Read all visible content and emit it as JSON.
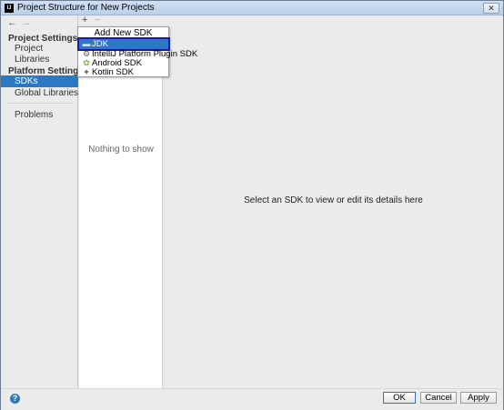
{
  "window": {
    "title": "Project Structure for New Projects",
    "close_glyph": "✕"
  },
  "nav": {
    "back_glyph": "←",
    "forward_glyph": "→"
  },
  "sidebar": {
    "project_settings_title": "Project Settings",
    "project_settings_items": [
      "Project",
      "Libraries"
    ],
    "platform_settings_title": "Platform Settings",
    "platform_settings_items": [
      "SDKs",
      "Global Libraries"
    ],
    "selected": "SDKs",
    "other_items": [
      "Problems"
    ]
  },
  "middle": {
    "add_glyph": "+",
    "remove_glyph": "−",
    "empty_text": "Nothing to show"
  },
  "popup": {
    "title": "Add New SDK",
    "items": [
      {
        "label": "JDK",
        "icon": "jdk-icon",
        "glyph": "▬"
      },
      {
        "label": "IntelliJ Platform Plugin SDK",
        "icon": "plugin-icon",
        "glyph": "⚙"
      },
      {
        "label": "Android SDK",
        "icon": "android-icon",
        "glyph": "✿"
      },
      {
        "label": "Kotlin SDK",
        "icon": "kotlin-icon",
        "glyph": "+"
      }
    ],
    "selected": "JDK"
  },
  "details": {
    "placeholder_text": "Select an SDK to view or edit its details here"
  },
  "footer": {
    "help_glyph": "?",
    "ok_label": "OK",
    "cancel_label": "Cancel",
    "apply_label": "Apply"
  },
  "colors": {
    "selection": "#2b79c4",
    "focus_outline": "#1a1ab0",
    "window_bg": "#ebebeb"
  }
}
